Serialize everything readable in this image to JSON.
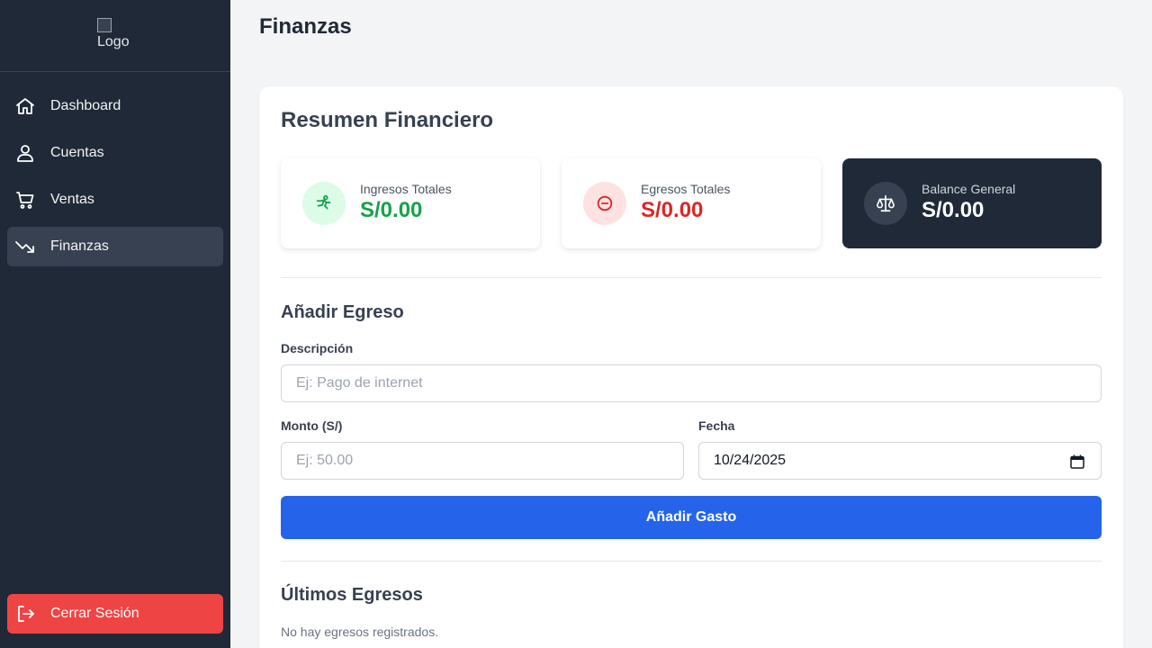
{
  "sidebar": {
    "logo_alt": "Logo",
    "items": [
      {
        "label": "Dashboard",
        "icon": "home-icon"
      },
      {
        "label": "Cuentas",
        "icon": "user-icon"
      },
      {
        "label": "Ventas",
        "icon": "cart-icon"
      },
      {
        "label": "Finanzas",
        "icon": "trending-down-icon",
        "active": true
      }
    ],
    "logout_label": "Cerrar Sesión"
  },
  "header": {
    "title": "Finanzas"
  },
  "summary": {
    "title": "Resumen Financiero",
    "income": {
      "label": "Ingresos Totales",
      "value": "S/0.00",
      "color": "#16a34a"
    },
    "expenses": {
      "label": "Egresos Totales",
      "value": "S/0.00",
      "color": "#dc2626"
    },
    "balance": {
      "label": "Balance General",
      "value": "S/0.00"
    }
  },
  "form": {
    "title": "Añadir Egreso",
    "description_label": "Descripción",
    "description_placeholder": "Ej: Pago de internet",
    "amount_label": "Monto (S/)",
    "amount_placeholder": "Ej: 50.00",
    "date_label": "Fecha",
    "date_value": "10/24/2025",
    "submit_label": "Añadir Gasto"
  },
  "expenses_list": {
    "title": "Últimos Egresos",
    "empty_text": "No hay egresos registrados."
  },
  "colors": {
    "sidebar_bg": "#1f2937",
    "accent": "#2563eb",
    "logout": "#ef4444"
  }
}
